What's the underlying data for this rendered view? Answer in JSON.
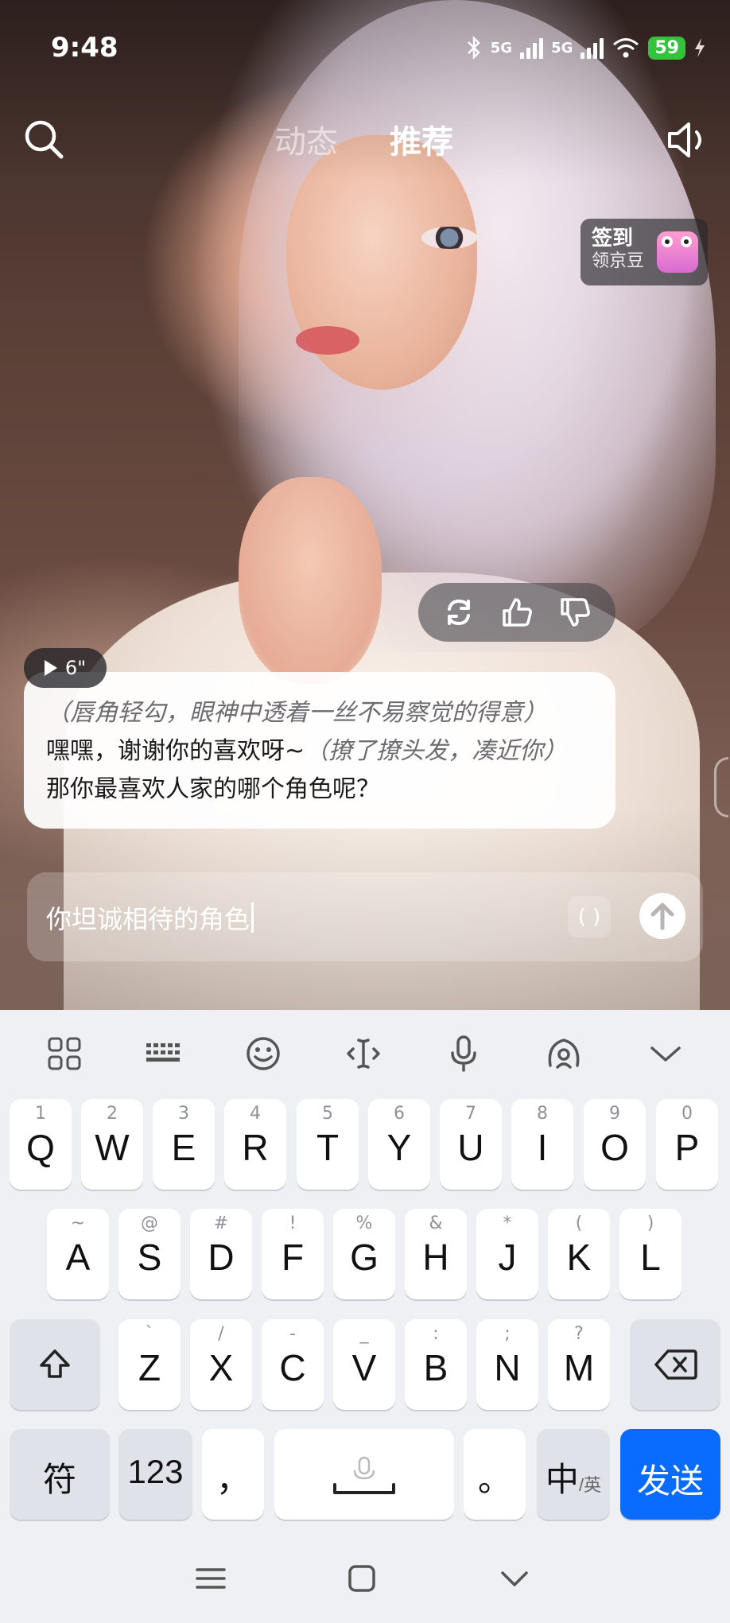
{
  "status_bar": {
    "time": "9:48",
    "network_1": "5G",
    "network_2": "5G",
    "battery": "59",
    "icons": [
      "bluetooth-icon",
      "signal-icon",
      "signal-icon",
      "wifi-icon",
      "charging-icon"
    ]
  },
  "nav": {
    "tabs": [
      {
        "label": "动态",
        "active": false
      },
      {
        "label": "推荐",
        "active": true
      }
    ],
    "icons": {
      "search": "search-icon",
      "sound": "speaker-icon"
    }
  },
  "signin_badge": {
    "title": "签到",
    "subtitle": "领京豆"
  },
  "message": {
    "voice_duration": "6\"",
    "lines": [
      {
        "text": "（唇角轻勾，眼神中透着一丝不易察觉的得意）",
        "style": "action"
      },
      {
        "text": "嘿嘿，谢谢你的喜欢呀~",
        "action": "（撩了撩头发，凑近你）"
      },
      {
        "text": "那你最喜欢人家的哪个角色呢？"
      }
    ]
  },
  "reactions": [
    "refresh-icon",
    "thumbs-up-icon",
    "thumbs-down-icon"
  ],
  "input": {
    "value": "你坦诚相待的角色",
    "paren_button": "( )"
  },
  "keyboard": {
    "toolbar": [
      "grid-icon",
      "keyboard-icon",
      "emoji-icon",
      "cursor-icon",
      "microphone-icon",
      "voice-assistant-icon",
      "collapse-icon"
    ],
    "row1": [
      {
        "k": "Q",
        "h": "1"
      },
      {
        "k": "W",
        "h": "2"
      },
      {
        "k": "E",
        "h": "3"
      },
      {
        "k": "R",
        "h": "4"
      },
      {
        "k": "T",
        "h": "5"
      },
      {
        "k": "Y",
        "h": "6"
      },
      {
        "k": "U",
        "h": "7"
      },
      {
        "k": "I",
        "h": "8"
      },
      {
        "k": "O",
        "h": "9"
      },
      {
        "k": "P",
        "h": "0"
      }
    ],
    "row2": [
      {
        "k": "A",
        "h": "~"
      },
      {
        "k": "S",
        "h": "@"
      },
      {
        "k": "D",
        "h": "#"
      },
      {
        "k": "F",
        "h": "!"
      },
      {
        "k": "G",
        "h": "%"
      },
      {
        "k": "H",
        "h": "&"
      },
      {
        "k": "J",
        "h": "*"
      },
      {
        "k": "K",
        "h": "("
      },
      {
        "k": "L",
        "h": ")"
      }
    ],
    "row3": [
      {
        "k": "Z",
        "h": "`"
      },
      {
        "k": "X",
        "h": "/"
      },
      {
        "k": "C",
        "h": "-"
      },
      {
        "k": "V",
        "h": "_"
      },
      {
        "k": "B",
        "h": ":"
      },
      {
        "k": "N",
        "h": ";"
      },
      {
        "k": "M",
        "h": "?"
      }
    ],
    "symbols_key": "符",
    "numbers_key": "123",
    "comma_key": "，",
    "period_key": "。",
    "lang_key": "中",
    "lang_key_sub": "/英",
    "send_key": "发送"
  },
  "colors": {
    "send_key": "#0A6CFF",
    "battery": "#35C23D",
    "keyboard_bg": "#EEF0F4"
  }
}
